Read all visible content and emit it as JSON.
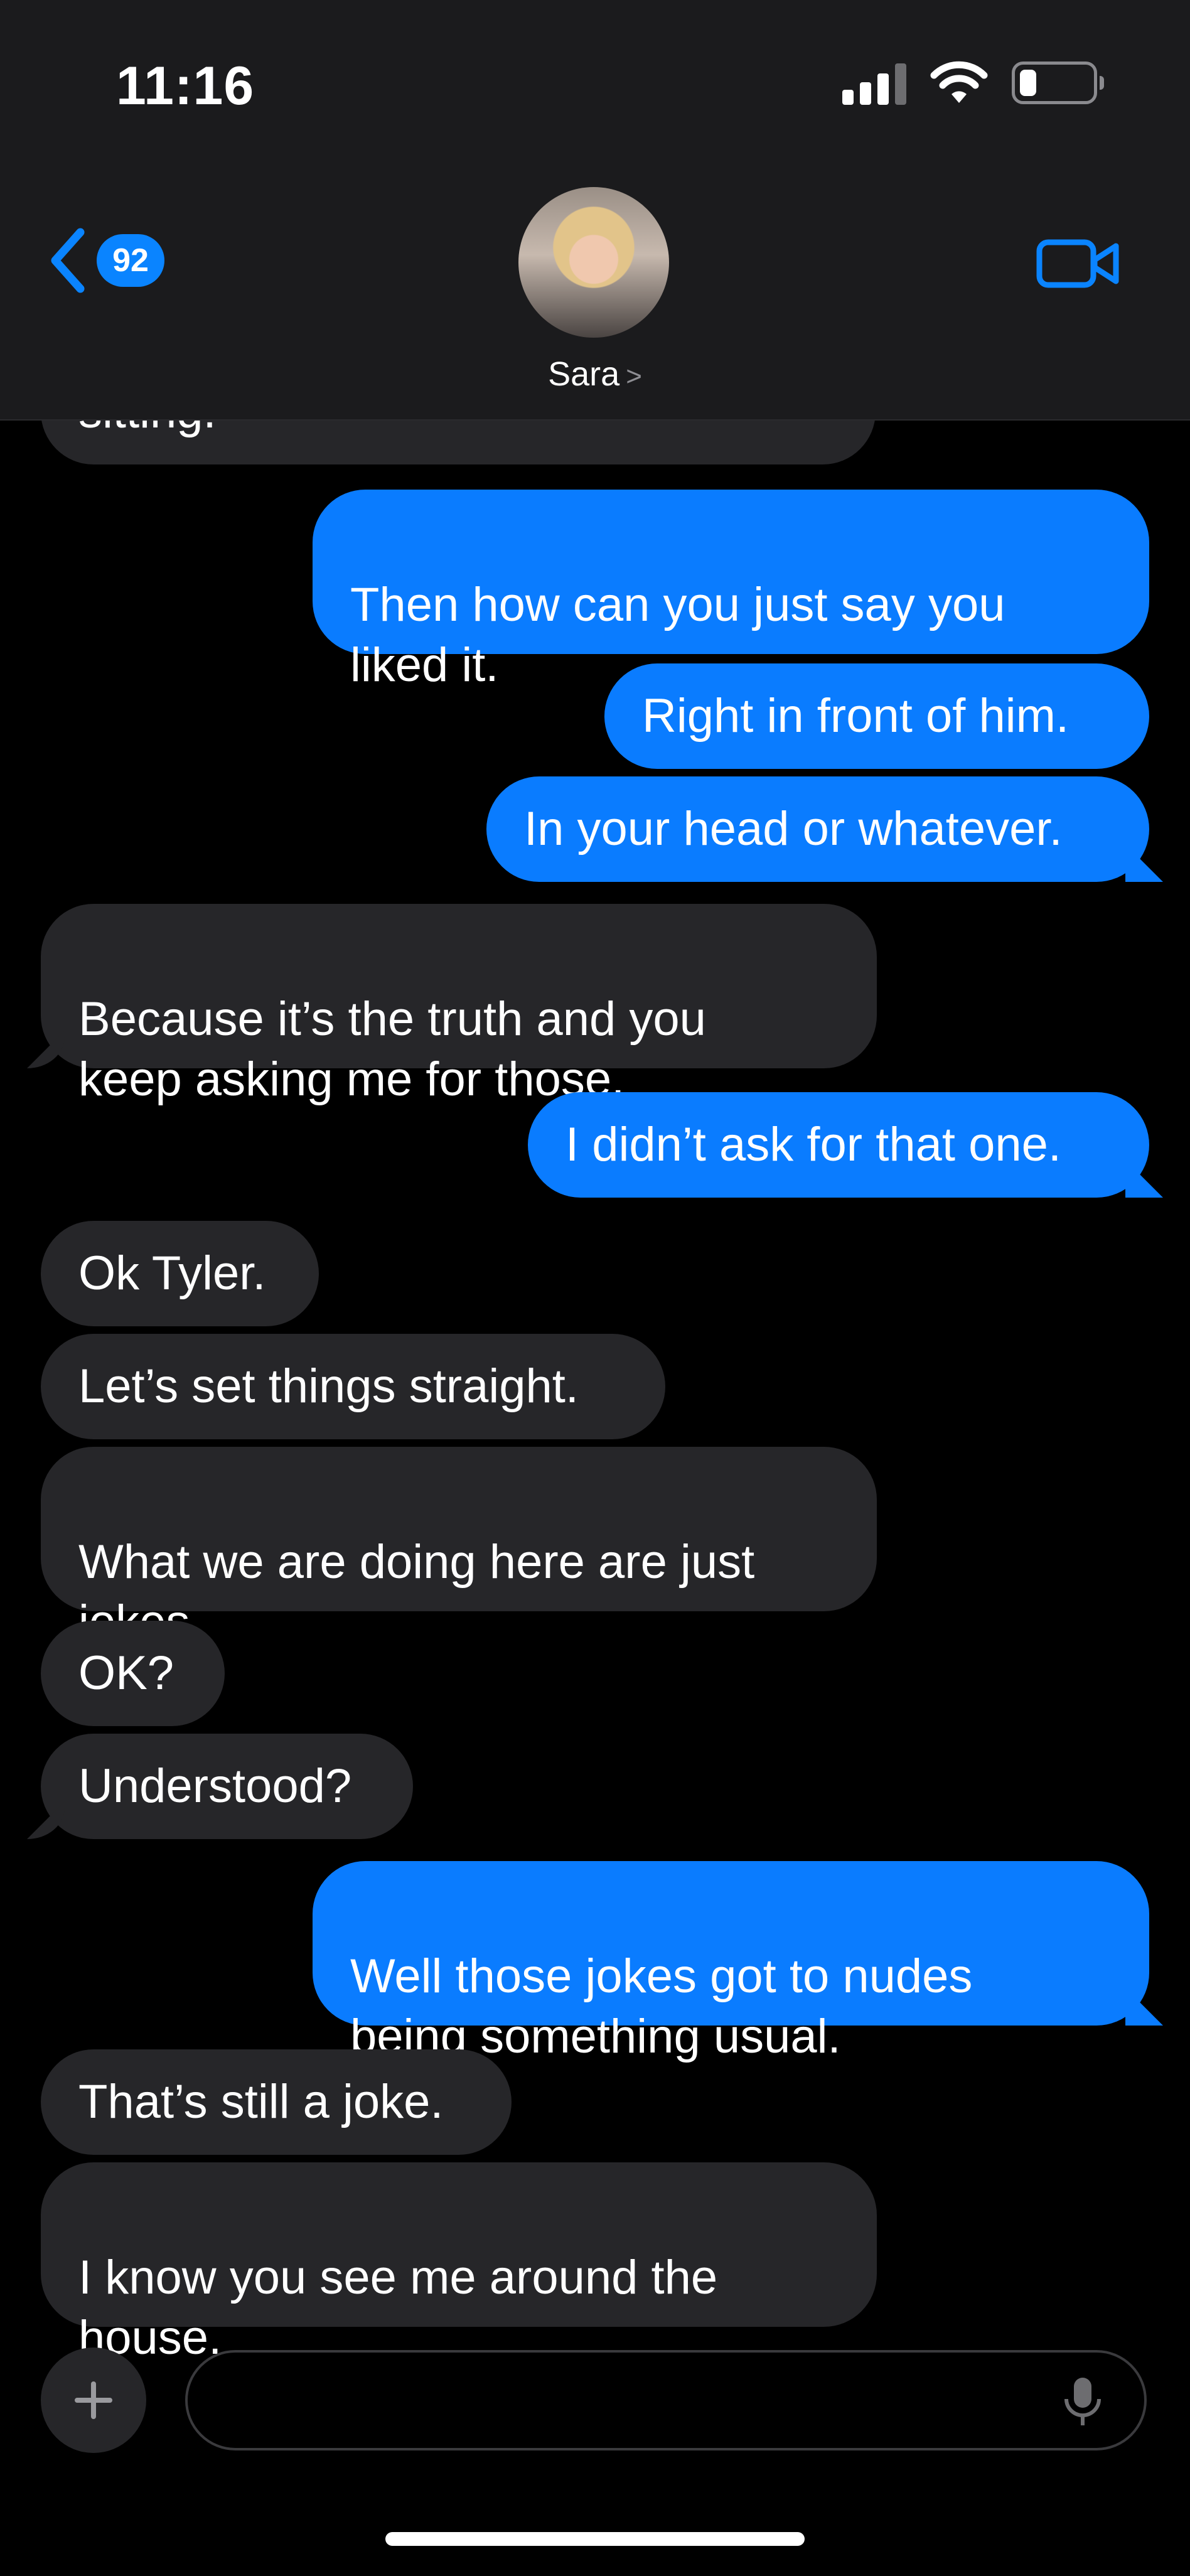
{
  "status_bar": {
    "time": "11:16"
  },
  "header": {
    "back_badge_count": "92",
    "contact_name": "Sara",
    "contact_chevron": ">"
  },
  "messages": [
    {
      "from": "them",
      "text": "sitting."
    },
    {
      "from": "me",
      "text": "Then how can you just say you\nliked it."
    },
    {
      "from": "me",
      "text": "Right in front of him."
    },
    {
      "from": "me",
      "text": "In your head or whatever."
    },
    {
      "from": "them",
      "text": "Because it’s the truth and you\nkeep asking me for those."
    },
    {
      "from": "me",
      "text": "I didn’t ask for that one."
    },
    {
      "from": "them",
      "text": "Ok Tyler."
    },
    {
      "from": "them",
      "text": "Let’s set things straight."
    },
    {
      "from": "them",
      "text": "What we are doing here are just\njokes."
    },
    {
      "from": "them",
      "text": "OK?"
    },
    {
      "from": "them",
      "text": "Understood?"
    },
    {
      "from": "me",
      "text": "Well those jokes got to nudes\nbeing something usual."
    },
    {
      "from": "them",
      "text": "That’s still a joke."
    },
    {
      "from": "them",
      "text": "I know you see me around the\nhouse."
    }
  ],
  "composer": {
    "placeholder": ""
  },
  "icons": {
    "back": "chevron-left-icon",
    "video": "video-camera-icon",
    "plus": "plus-icon",
    "mic": "microphone-icon"
  },
  "colors": {
    "accent": "#0a84ff",
    "incoming_bubble": "#262629",
    "outgoing_bubble": "#0a7cff"
  }
}
